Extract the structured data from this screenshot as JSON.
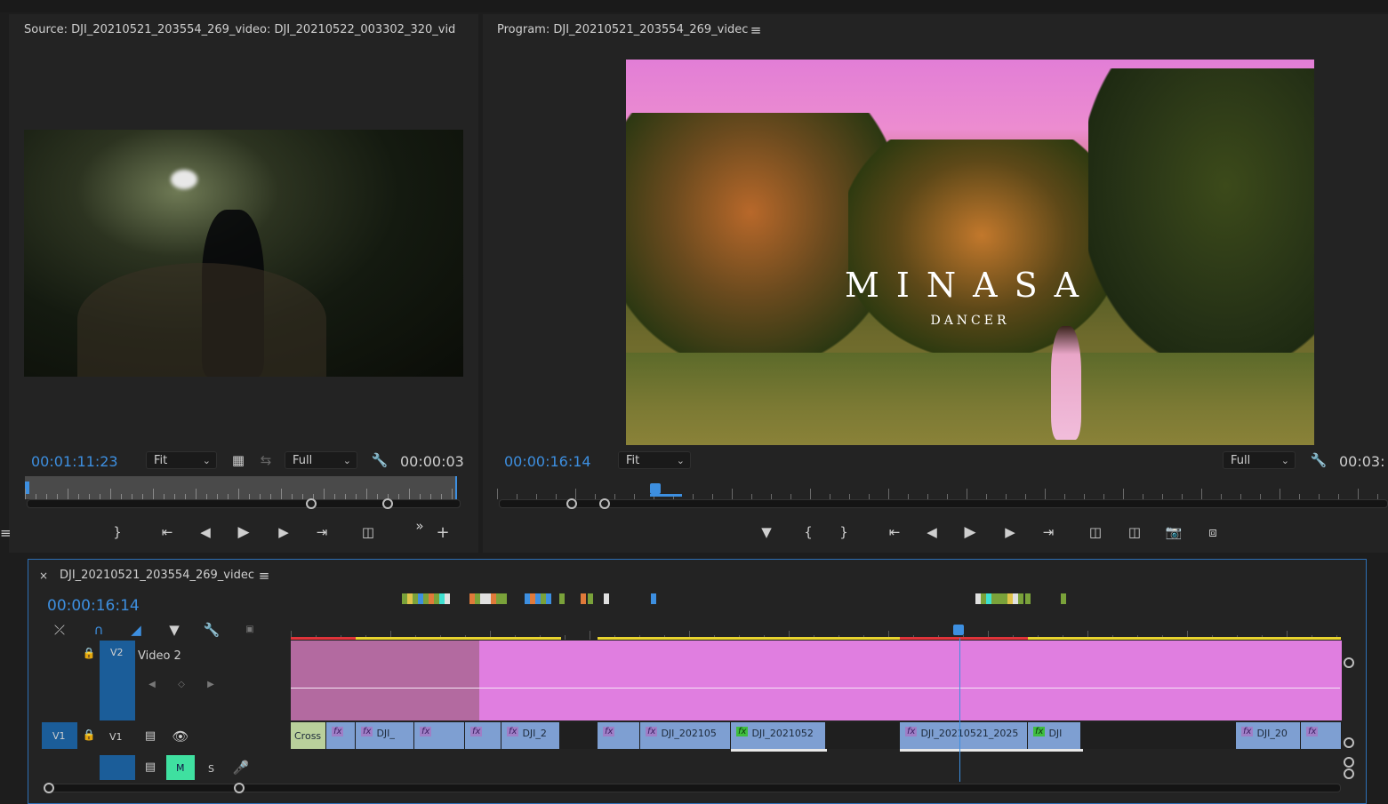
{
  "source": {
    "title": "Source: DJI_20210521_203554_269_video: DJI_20210522_003302_320_vid",
    "timecode": "00:01:11:23",
    "fit": "Fit",
    "quality": "Full",
    "duration": "00:00:03"
  },
  "program": {
    "title": "Program: DJI_20210521_203554_269_videc",
    "timecode": "00:00:16:14",
    "fit": "Fit",
    "quality": "Full",
    "duration": "00:03:",
    "overlay_title": "MINASA",
    "overlay_subtitle": "DANCER"
  },
  "timeline": {
    "tab_title": "DJI_20210521_203554_269_videc",
    "timecode": "00:00:16:14",
    "tracks": {
      "v2_target": "V2",
      "v2_name": "Video 2",
      "v1_source": "V1",
      "v1_target": "V1",
      "a_mute": "M",
      "a_solo": "S"
    },
    "v1_clips": [
      {
        "label": "Cross",
        "color": "green",
        "fx": false
      },
      {
        "label": "",
        "color": "blue",
        "fx": true
      },
      {
        "label": "DJI_",
        "color": "blue",
        "fx": true
      },
      {
        "label": "",
        "color": "blue",
        "fx": true
      },
      {
        "label": "",
        "color": "blue",
        "fx": true
      },
      {
        "label": "DJI_2",
        "color": "blue",
        "fx": true
      },
      {
        "label": "",
        "color": "blue",
        "fx": true
      },
      {
        "label": "DJI_202105",
        "color": "blue",
        "fx": true
      },
      {
        "label": "DJI_2021052",
        "color": "green",
        "fx": true
      },
      {
        "label": "DJI_20210521_2025",
        "color": "blue",
        "fx": true
      },
      {
        "label": "DJI",
        "color": "green",
        "fx": true
      },
      {
        "label": "DJI_20",
        "color": "blue",
        "fx": true
      },
      {
        "label": "",
        "color": "blue",
        "fx": true
      }
    ]
  },
  "icons": {
    "panel_menu": "hamburger-icon",
    "wrench": "wrench-icon",
    "play": "play-icon",
    "camera": "camera-icon",
    "lock": "lock-icon",
    "eye": "eye-icon",
    "mic": "microphone-icon",
    "close": "close-icon"
  },
  "colors": {
    "accent_timecode": "#3d8fe0",
    "v2_clip": "#e07ee0",
    "v1_clip": "#7e9fd2",
    "playhead": "#3d8fe0"
  }
}
